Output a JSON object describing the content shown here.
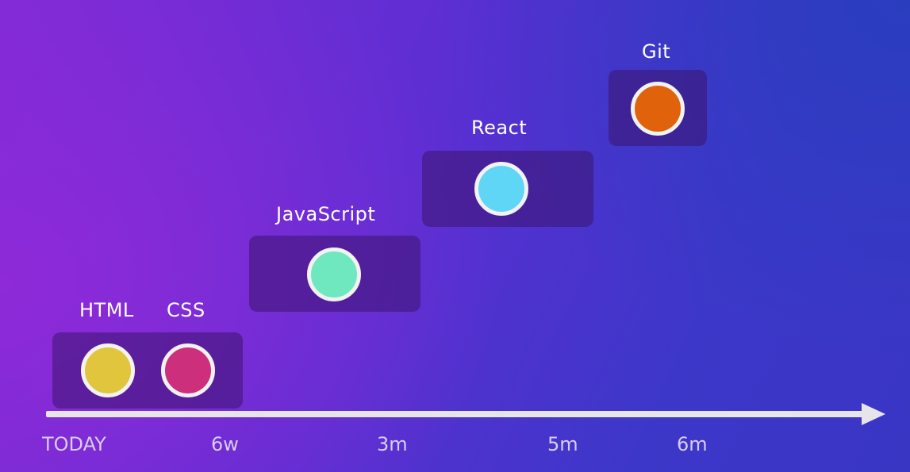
{
  "skills": [
    {
      "label": "HTML",
      "color": "#e0c53d"
    },
    {
      "label": "CSS",
      "color": "#cc2f7c"
    },
    {
      "label": "JavaScript",
      "color": "#6fe8c0"
    },
    {
      "label": "React",
      "color": "#5fd6f5"
    },
    {
      "label": "Git",
      "color": "#e0620a"
    }
  ],
  "timeline": {
    "ticks": [
      "TODAY",
      "6w",
      "3m",
      "5m",
      "6m"
    ]
  }
}
